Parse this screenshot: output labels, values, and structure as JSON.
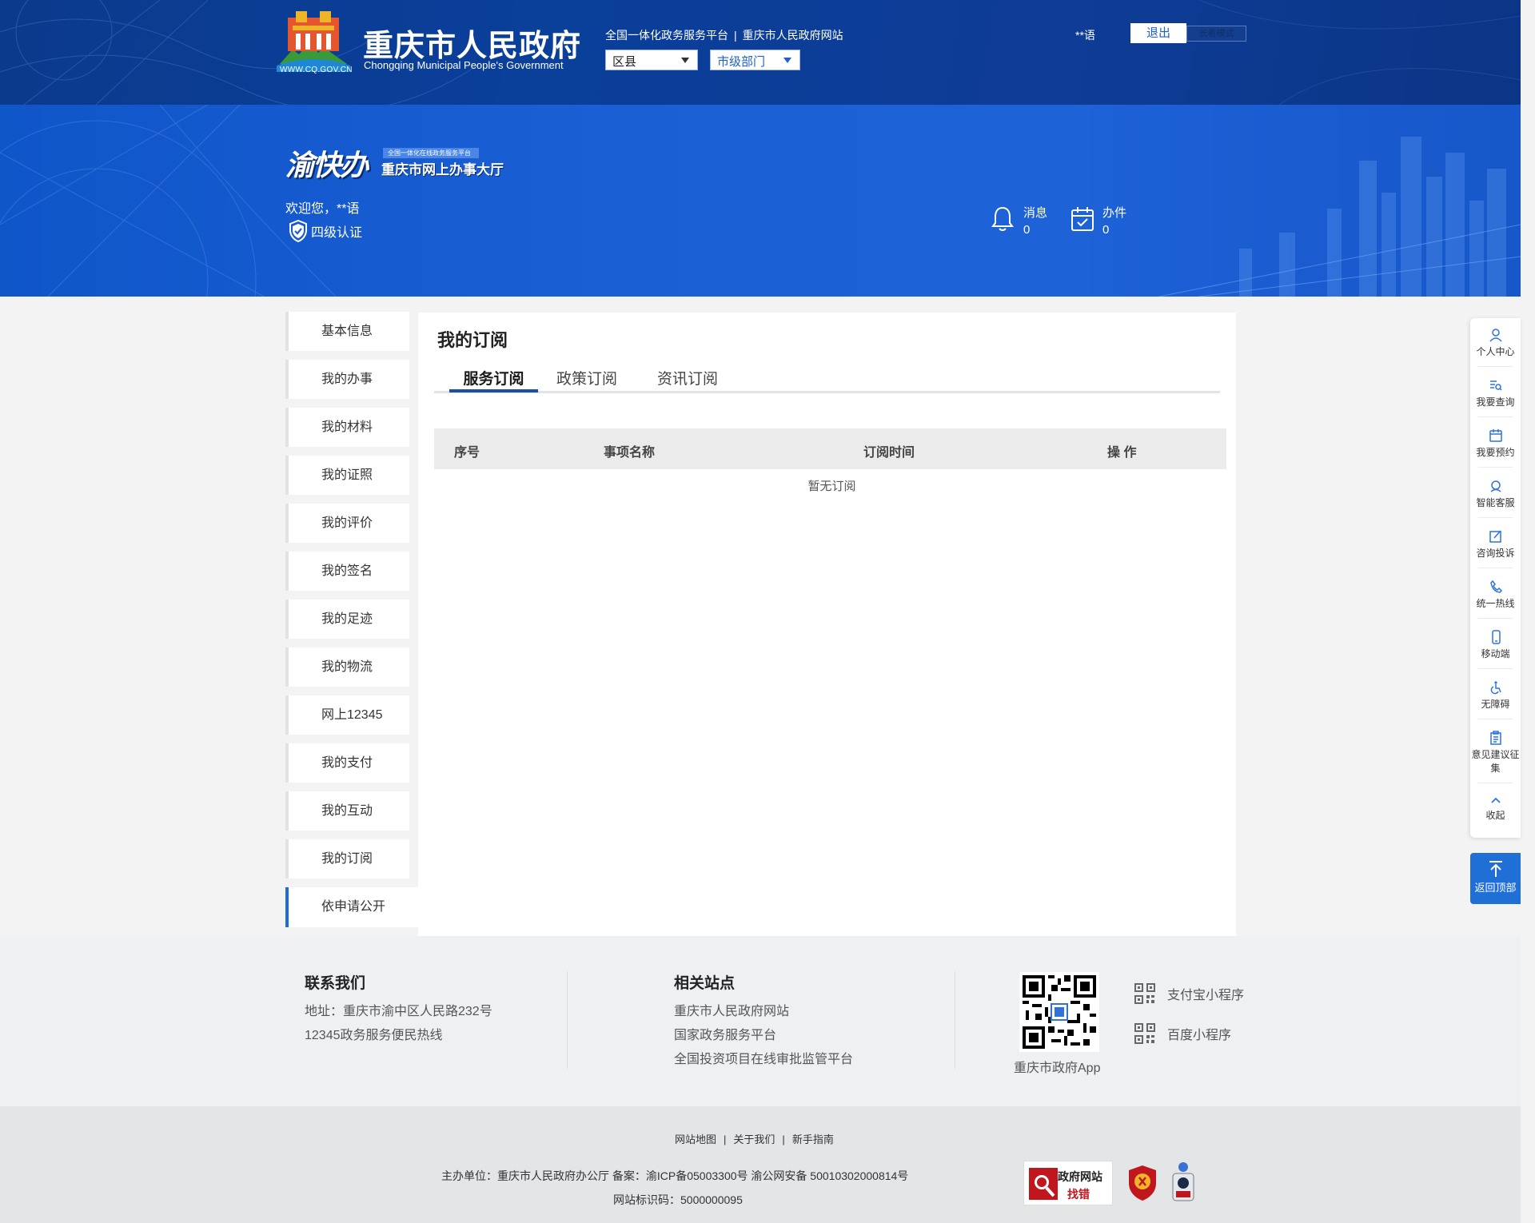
{
  "header": {
    "logo_url_text": "WWW.CQ.GOV.CN",
    "gov_name_cn": "重庆市人民政府",
    "gov_name_en": "Chongqing Municipal People's Government",
    "links": [
      "全国一体化政务服务平台",
      "重庆市人民政府网站"
    ],
    "link_separator": "|",
    "district_select": "区县",
    "city_select": "市级部门",
    "user": "**语",
    "logout_label": "退出",
    "elder_mode_label": "长者模式"
  },
  "banner": {
    "platform_logo": "渝快办",
    "platform_tag": "全国一体化在线政务服务平台",
    "platform_sub": "重庆市网上办事大厅",
    "welcome": "欢迎您，**语",
    "cert_level": "四级认证",
    "messages_label": "消息",
    "messages_count": "0",
    "tasks_label": "办件",
    "tasks_count": "0"
  },
  "sidebar": {
    "items": [
      {
        "label": "基本信息"
      },
      {
        "label": "我的办事"
      },
      {
        "label": "我的材料"
      },
      {
        "label": "我的证照"
      },
      {
        "label": "我的评价"
      },
      {
        "label": "我的签名"
      },
      {
        "label": "我的足迹"
      },
      {
        "label": "我的物流"
      },
      {
        "label": "网上12345"
      },
      {
        "label": "我的支付"
      },
      {
        "label": "我的互动"
      },
      {
        "label": "我的订阅"
      },
      {
        "label": "依申请公开"
      }
    ],
    "active_index": 12
  },
  "main": {
    "title": "我的订阅",
    "tabs": [
      {
        "label": "服务订阅",
        "active": true
      },
      {
        "label": "政策订阅",
        "active": false
      },
      {
        "label": "资讯订阅",
        "active": false
      }
    ],
    "table": {
      "columns": [
        "序号",
        "事项名称",
        "订阅时间",
        "操 作"
      ],
      "empty_text": "暂无订阅"
    }
  },
  "right_toolbar": {
    "items": [
      {
        "label": "个人中心",
        "icon": "person-icon"
      },
      {
        "label": "我要查询",
        "icon": "search-list-icon"
      },
      {
        "label": "我要预约",
        "icon": "calendar-icon"
      },
      {
        "label": "智能客服",
        "icon": "headset-icon"
      },
      {
        "label": "咨询投诉",
        "icon": "edit-icon"
      },
      {
        "label": "统一热线",
        "icon": "phone-icon"
      },
      {
        "label": "移动端",
        "icon": "mobile-icon"
      },
      {
        "label": "无障碍",
        "icon": "wheelchair-icon"
      },
      {
        "label": "意见建议征集",
        "icon": "clipboard-icon"
      },
      {
        "label": "收起",
        "icon": "chevron-up-icon"
      }
    ],
    "back_to_top": "返回顶部"
  },
  "footer": {
    "contact_title": "联系我们",
    "address": "地址：重庆市渝中区人民路232号",
    "hotline": "12345政务服务便民热线",
    "related_title": "相关站点",
    "related_links": [
      "重庆市人民政府网站",
      "国家政务服务平台",
      "全国投资项目在线审批监管平台"
    ],
    "app_label": "重庆市政府App",
    "mini_programs": [
      "支付宝小程序",
      "百度小程序"
    ],
    "bottom_links": [
      "网站地图",
      "关于我们",
      "新手指南"
    ],
    "sponsor_info": "主办单位：重庆市人民政府办公厅 备案：渝ICP备05003300号 渝公网安备 50010302000814号",
    "site_id": "网站标识码：5000000095",
    "badge_title": "政府网站",
    "badge_action": "找错"
  },
  "colors": {
    "header_bg": "#0b3a8c",
    "banner_bg": "#1a5fd4",
    "accent": "#1f6bd6",
    "active_tab_underline": "#1a4fa8"
  }
}
